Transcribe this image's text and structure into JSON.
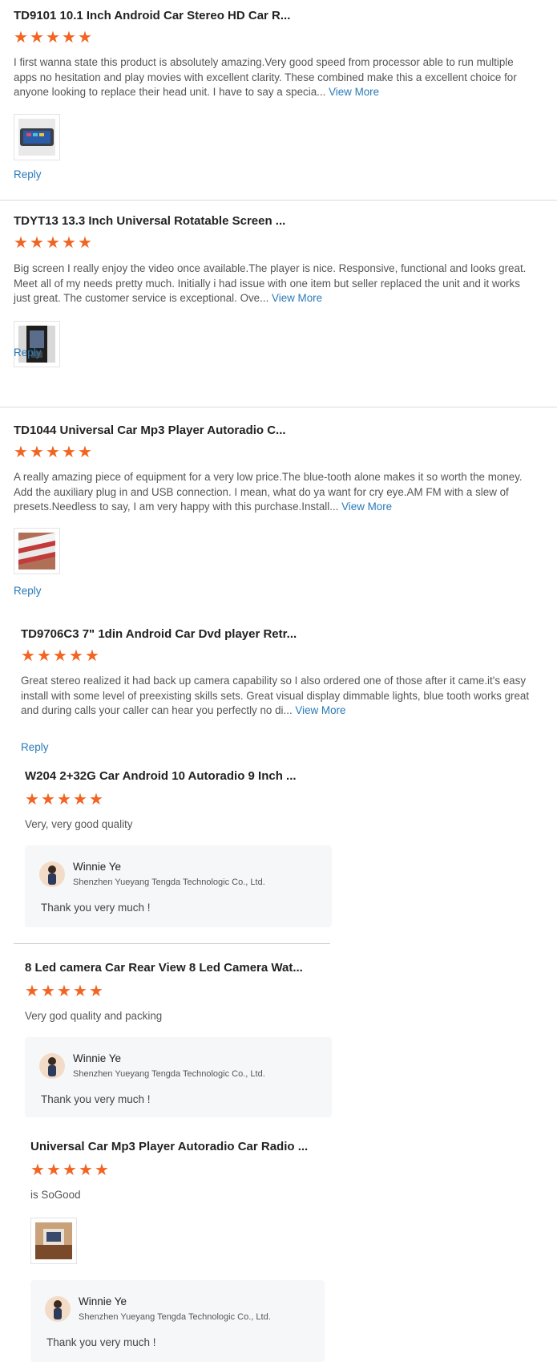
{
  "reviews": [
    {
      "title": "TD9101 10.1 Inch Android Car Stereo HD Car R...",
      "rating": 5,
      "text": "I first wanna state this product is absolutely amazing.Very good speed from processor able to run multiple apps no hesitation and play movies with excellent clarity. These combined make this a excellent choice for anyone looking to replace their head unit.  I have to say a specia...",
      "view_more": "View More",
      "reply": "Reply"
    },
    {
      "title": "TDYT13 13.3 Inch Universal Rotatable Screen ...",
      "rating": 5,
      "text": "Big screen I really enjoy the video once available.The player is nice.  Responsive, functional and looks great. Meet all of my needs pretty much.  Initially i had issue with one item but seller replaced the unit and it works just great.  The customer service is exceptional.  Ove...",
      "view_more": "View More",
      "reply": "Reply"
    },
    {
      "title": "TD1044 Universal Car Mp3 Player Autoradio C...",
      "rating": 5,
      "text": "A really amazing piece of equipment for a very low price.The blue-tooth alone makes it so worth the money. Add the auxiliary plug in and USB connection.    I mean, what do ya want for cry eye.AM FM with a slew of presets.Needless to say, I am very happy with this purchase.Install...",
      "view_more": "View More",
      "reply": "Reply"
    },
    {
      "title": "TD9706C3 7\" 1din Android Car Dvd player Retr...",
      "rating": 5,
      "text": "Great stereo realized it had back up camera capability so I also ordered one of those after it came.it's easy install with some level of preexisting skills sets.  Great visual display dimmable lights, blue tooth works great and during calls your caller can hear you perfectly no di...",
      "view_more": "View More",
      "reply": "Reply"
    },
    {
      "title": "W204 2+32G Car Android 10 Autoradio 9 Inch ...",
      "rating": 5,
      "text": "Very, very good quality",
      "seller_reply": {
        "name": "Winnie Ye",
        "company": "Shenzhen Yueyang Tengda Technologic Co., Ltd.",
        "text": "Thank you very much !"
      }
    },
    {
      "title": "8 Led camera Car Rear View 8 Led Camera Wat...",
      "rating": 5,
      "text": "Very god quality and packing",
      "seller_reply": {
        "name": "Winnie Ye",
        "company": "Shenzhen Yueyang Tengda Technologic Co., Ltd.",
        "text": "Thank you very much !"
      }
    },
    {
      "title": "Universal Car Mp3 Player Autoradio Car Radio ...",
      "rating": 5,
      "text": "is SoGood",
      "seller_reply": {
        "name": "Winnie Ye",
        "company": "Shenzhen Yueyang Tengda Technologic Co., Ltd.",
        "text": "Thank you very much !"
      }
    }
  ],
  "colors": {
    "star": "#f26422",
    "link": "#2a7ab8",
    "reply_bg": "#f6f7f8"
  },
  "icons": {
    "star": "star-icon",
    "avatar": "seller-avatar"
  }
}
